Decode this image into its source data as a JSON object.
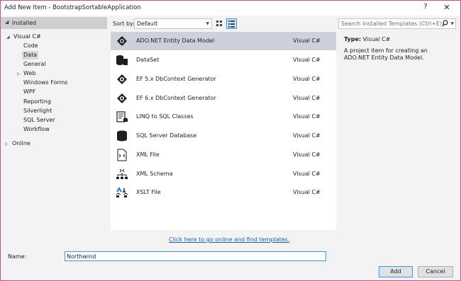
{
  "window": {
    "title": "Add New Item - BootstrapSortableApplication",
    "help_glyph": "?",
    "close_glyph": "✕",
    "border_color": "#c74ea0"
  },
  "left_panel": {
    "installed_label": "Installed",
    "visual_csharp_label": "Visual C#",
    "children": [
      "Code",
      "Data",
      "General",
      "Web",
      "Windows Forms",
      "WPF",
      "Reporting",
      "Silverlight",
      "SQL Server",
      "Workflow"
    ],
    "selected": "Data",
    "online_label": "Online"
  },
  "toolbar": {
    "sort_label": "Sort by:",
    "sort_value": "Default"
  },
  "search": {
    "placeholder": "Search Installed Templates (Ctrl+E)"
  },
  "templates": [
    {
      "name": "ADO.NET Entity Data Model",
      "language": "Visual C#",
      "icon": "entity-model-icon",
      "selected": true
    },
    {
      "name": "DataSet",
      "language": "Visual C#",
      "icon": "dataset-icon"
    },
    {
      "name": "EF 5.x DbContext Generator",
      "language": "Visual C#",
      "icon": "dbcontext-generator-icon"
    },
    {
      "name": "EF 6.x DbContext Generator",
      "language": "Visual C#",
      "icon": "dbcontext-generator-icon"
    },
    {
      "name": "LINQ to SQL Classes",
      "language": "Visual C#",
      "icon": "linq-to-sql-icon"
    },
    {
      "name": "SQL Server Database",
      "language": "Visual C#",
      "icon": "database-icon"
    },
    {
      "name": "XML File",
      "language": "Visual C#",
      "icon": "xml-file-icon"
    },
    {
      "name": "XML Schema",
      "language": "Visual C#",
      "icon": "xml-schema-icon"
    },
    {
      "name": "XSLT File",
      "language": "Visual C#",
      "icon": "xslt-file-icon"
    }
  ],
  "details": {
    "type_label": "Type:",
    "type_value": "Visual C#",
    "description": "A project item for creating an ADO.NET Entity Data Model."
  },
  "online_link": "Click here to go online and find templates.",
  "name_field": {
    "label": "Name:",
    "value": "Northwind"
  },
  "buttons": {
    "add": "Add",
    "cancel": "Cancel"
  }
}
